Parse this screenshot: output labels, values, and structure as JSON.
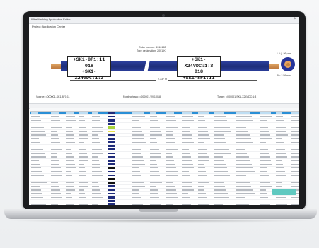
{
  "window": {
    "title": "Wire Marking Application Editor",
    "close": "×"
  },
  "project": {
    "label": "Project: Application Center"
  },
  "graphic": {
    "order_line1": "Order number: 4310152",
    "order_line2": "Type designation: 2001-K",
    "left_label": [
      "+SK1-8F1:11",
      "018",
      "+SK1-X24VDC:1:3"
    ],
    "right_label": [
      "+SK1-X24VDC:1:3",
      "018",
      "+SK1-8F1:11"
    ],
    "length": "2.337 m",
    "source": "Source: =000001-SK1-8F1:11",
    "routing": "Routing track: =000001-W01-018",
    "target": "Target: =000001-SK1-X24VDC:1:3",
    "xsec_top": "1.5 (1.56) mm",
    "xsec_side": "Ø = 2.56 mm"
  },
  "colors": {
    "cable": "#2c3f9c",
    "copper": "#d8975a",
    "selection": "#2a8fd6",
    "accent": "#5fc9c0"
  }
}
